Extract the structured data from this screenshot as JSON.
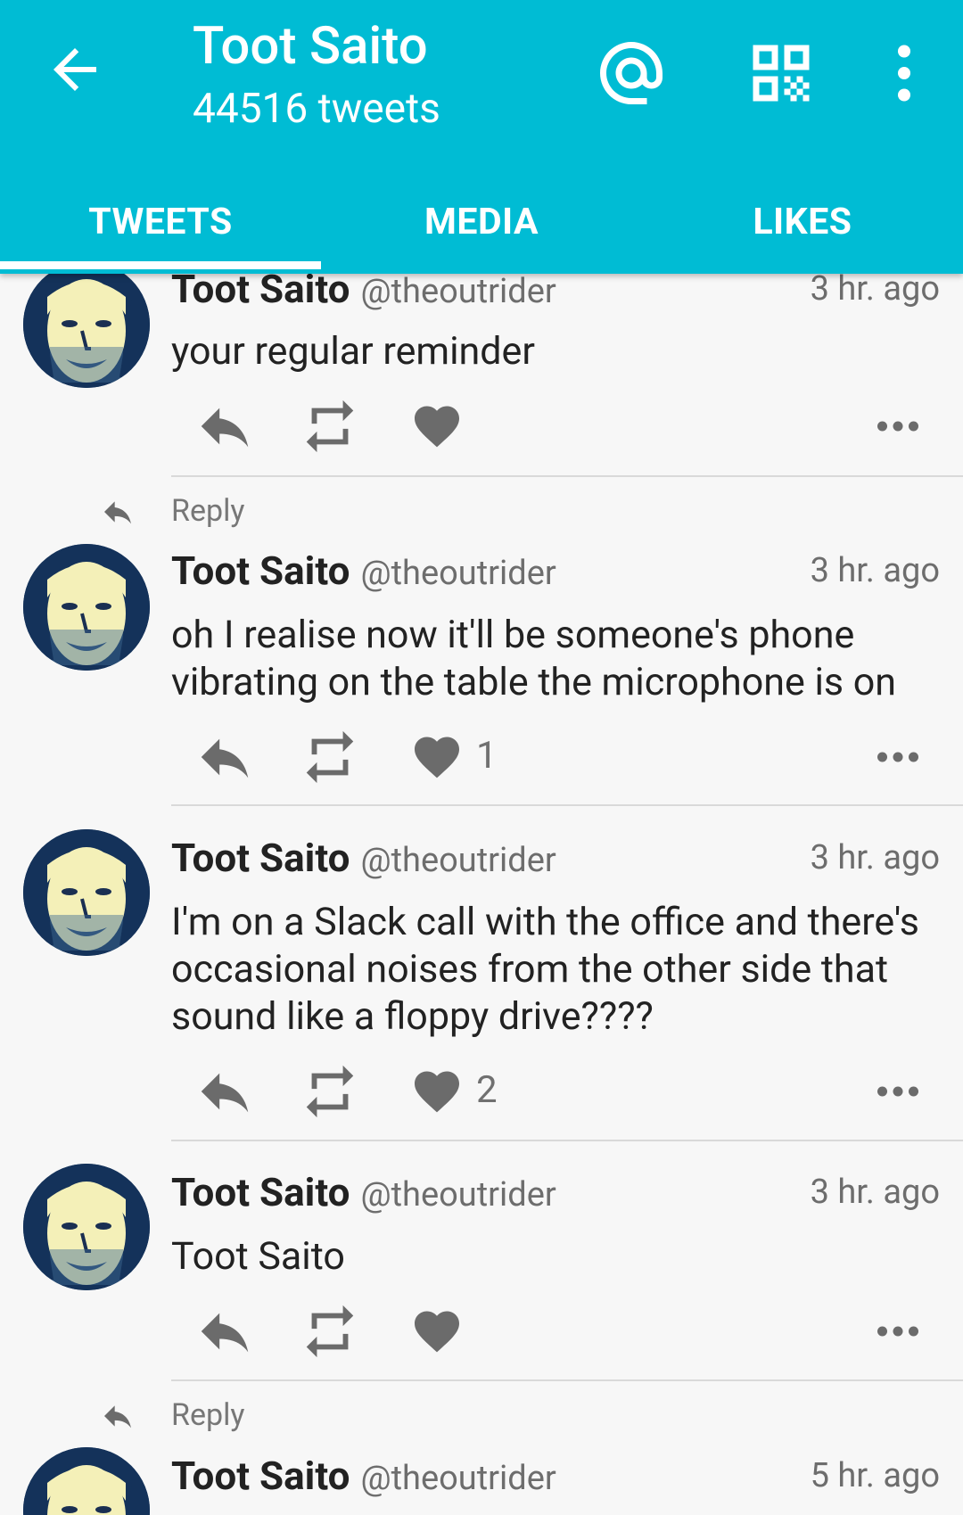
{
  "header": {
    "title": "Toot Saito",
    "subtitle": "44516 tweets",
    "tabs": [
      {
        "label": "TWEETS",
        "active": true
      },
      {
        "label": "MEDIA",
        "active": false
      },
      {
        "label": "LIKES",
        "active": false
      }
    ],
    "accent_color": "#00bcd4"
  },
  "tweets": [
    {
      "name": "Toot Saito",
      "handle": "@theoutrider",
      "time": "3 hr. ago",
      "text": "your regular reminder",
      "likes": ""
    },
    {
      "reply_label": "Reply",
      "name": "Toot Saito",
      "handle": "@theoutrider",
      "time": "3 hr. ago",
      "text": "oh I realise now it'll be someone's phone vibrating on the table the microphone is on",
      "likes": "1"
    },
    {
      "name": "Toot Saito",
      "handle": "@theoutrider",
      "time": "3 hr. ago",
      "text": "I'm on a Slack call with the office and there's occasional noises from the other side that sound like a floppy drive????",
      "likes": "2"
    },
    {
      "name": "Toot Saito",
      "handle": "@theoutrider",
      "time": "3 hr. ago",
      "text": "Toot Saito",
      "likes": ""
    },
    {
      "reply_label": "Reply",
      "name": "Toot Saito",
      "handle": "@theoutrider",
      "time": "5 hr. ago"
    }
  ],
  "icons": {
    "back": "arrow-back-icon",
    "mention": "at-sign-icon",
    "qr": "qr-code-icon",
    "menu": "more-vertical-icon",
    "reply": "reply-icon",
    "retweet": "retweet-icon",
    "like": "heart-icon",
    "more": "more-horizontal-icon"
  }
}
